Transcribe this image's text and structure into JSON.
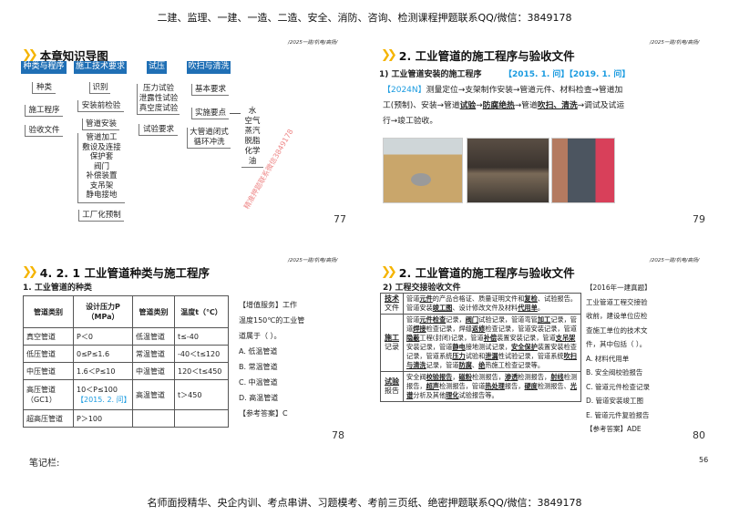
{
  "top_banner": "二建、监理、一建、一造、二造、安全、消防、咨询、检测课程押题联系QQ/微信：3849178",
  "bottom_banner": "名师面授精华、央企内训、考点串讲、习题模考、考前三页纸、绝密押题联系QQ/微信：3849178",
  "notes_label": "笔记栏:",
  "sheet_page": "56",
  "slide_header": "/2025一建/机电/高扬/",
  "watermark": "精准押题联系微信3849178",
  "slide77": {
    "title": "本章知识导图",
    "page": "77",
    "col1": {
      "head": "种类与程序",
      "items": [
        "种类",
        "施工程序",
        "验收文件"
      ]
    },
    "col2": {
      "head": "施工技术要求",
      "items": [
        "识别",
        "安装前检验",
        "管道安装"
      ],
      "install": [
        "管道加工",
        "敷设及连接",
        "保护套",
        "阀门",
        "补偿装置",
        "支吊架",
        "静电接地"
      ],
      "last": "工厂化预制"
    },
    "col3": {
      "head": "试压",
      "tests": [
        "压力试验",
        "泄露性试验",
        "真空度试验"
      ],
      "req": "试验要求"
    },
    "col4": {
      "head": "吹扫与清洗",
      "items": [
        "基本要求",
        "实施要点"
      ],
      "big": [
        "大管道闭式",
        "循环冲洗"
      ],
      "media": [
        "水",
        "空气",
        "蒸汽",
        "脱脂",
        "化学",
        "油"
      ]
    }
  },
  "slide79": {
    "title": "2. 工业管道的施工程序与验收文件",
    "page": "79",
    "subtitle": "1) 工业管道安装的施工程序",
    "tags": "【2015. 1. 问】【2019. 1. 问】",
    "paragraph": [
      {
        "t": "【2024N】",
        "c": "tag"
      },
      {
        "t": "测量定位→支架制作安装→管道元件、材料检查→管道加工(预制)、安装→管道"
      },
      {
        "t": "试验",
        "u": 1
      },
      {
        "t": "→"
      },
      {
        "t": "防腐绝热",
        "u": 1
      },
      {
        "t": "→管道"
      },
      {
        "t": "吹扫、清洗",
        "u": 1
      },
      {
        "t": "→调试及试运行→竣工验收。"
      }
    ]
  },
  "slide78": {
    "title": "4. 2. 1  工业管道种类与施工程序",
    "page": "78",
    "subtitle": "1. 工业管道的种类",
    "table": {
      "headers": [
        "管道类别",
        "设计压力P（MPa）",
        "管道类别",
        "温度t（℃）"
      ],
      "rows": [
        [
          "真空管道",
          "P＜0",
          "低温管道",
          "t≤-40"
        ],
        [
          "低压管道",
          "0≤P≤1.6",
          "常温管道",
          "-40＜t≤120"
        ],
        [
          "中压管道",
          "1.6＜P≤10",
          "中温管道",
          "120＜t≤450"
        ],
        [
          "高压管道（GC1）",
          "10＜P≤100",
          "高温管道",
          "t＞450"
        ],
        [
          "超高压管道",
          "P＞100",
          "",
          ""
        ]
      ],
      "tag": "【2015. 2. 问】"
    },
    "question": [
      "【增值服务】工作",
      "温度150℃的工业管",
      "道属于（   ）。",
      "A. 低温管道",
      "B. 常温管道",
      "C. 中温管道",
      "D. 高温管道",
      "【参考答案】C"
    ]
  },
  "slide80": {
    "title": "2. 工业管道的施工程序与验收文件",
    "page": "80",
    "subtitle": "2) 工程交接验收文件",
    "rows": [
      {
        "k": [
          "技术",
          "文件"
        ],
        "v": [
          {
            "t": "管道"
          },
          {
            "t": "元件",
            "u": 1
          },
          {
            "t": "的产品合格证、质量证明文件和"
          },
          {
            "t": "复检",
            "u": 1
          },
          {
            "t": "、试验报告。管道安装"
          },
          {
            "t": "竣工图",
            "u": 1
          },
          {
            "t": "、设计修改文件及材料"
          },
          {
            "t": "代用单",
            "u": 1
          },
          {
            "t": "。"
          }
        ]
      },
      {
        "k": [
          "施工",
          "记录"
        ],
        "v": [
          {
            "t": "管道"
          },
          {
            "t": "元件检查",
            "u": 1
          },
          {
            "t": "记录，"
          },
          {
            "t": "阀门",
            "u": 1
          },
          {
            "t": "试验记录，管道弯管"
          },
          {
            "t": "加工",
            "u": 1
          },
          {
            "t": "记录，管道"
          },
          {
            "t": "焊接",
            "u": 1
          },
          {
            "t": "检查记录，焊缝"
          },
          {
            "t": "返修",
            "u": 1
          },
          {
            "t": "检查记录，管道安装记录，管道"
          },
          {
            "t": "隐蔽",
            "u": 1
          },
          {
            "t": "工程(封闭)记录，管道"
          },
          {
            "t": "补偿",
            "u": 1
          },
          {
            "t": "装置安装记录，管道"
          },
          {
            "t": "支吊架",
            "u": 1
          },
          {
            "t": "安装记录，管道"
          },
          {
            "t": "静电",
            "u": 1
          },
          {
            "t": "接地测试记录，"
          },
          {
            "t": "安全保护",
            "u": 1
          },
          {
            "t": "装置安装检查记录，管道系统"
          },
          {
            "t": "压力",
            "u": 1
          },
          {
            "t": "试验和"
          },
          {
            "t": "泄漏",
            "u": 1
          },
          {
            "t": "性试验记录，管道系统"
          },
          {
            "t": "吹扫与清洗",
            "u": 1
          },
          {
            "t": "记录，管道"
          },
          {
            "t": "防腐",
            "u": 1
          },
          {
            "t": "、"
          },
          {
            "t": "绝",
            "u": 1
          },
          {
            "t": "热施工检查记录等。"
          }
        ]
      },
      {
        "k": [
          "试验",
          "报告"
        ],
        "v": [
          {
            "t": "安全阀"
          },
          {
            "t": "校验报告",
            "u": 1
          },
          {
            "t": "，"
          },
          {
            "t": "磁粉",
            "u": 1
          },
          {
            "t": "检测报告，"
          },
          {
            "t": "渗透",
            "u": 1
          },
          {
            "t": "检测报告，"
          },
          {
            "t": "射线",
            "u": 1
          },
          {
            "t": "检测报告，"
          },
          {
            "t": "超声",
            "u": 1
          },
          {
            "t": "检测报告，管道"
          },
          {
            "t": "热处理",
            "u": 1
          },
          {
            "t": "报告，"
          },
          {
            "t": "硬度",
            "u": 1
          },
          {
            "t": "检测报告、"
          },
          {
            "t": "光谱",
            "u": 1
          },
          {
            "t": "分析及其他"
          },
          {
            "t": "理化",
            "u": 1
          },
          {
            "t": "试验报告等。"
          }
        ]
      }
    ],
    "question": [
      "【2016年一建真题】",
      "工业管道工程交接验",
      "收前，建设单位应检",
      "查施工单位的技术文",
      "件，其中包括（   ）。",
      "A. 材料代用单",
      "B. 安全阀校验报告",
      "C. 管道元件检查记录",
      "D. 管道安装竣工图",
      "E. 管道元件复验报告",
      "【参考答案】ADE"
    ]
  }
}
